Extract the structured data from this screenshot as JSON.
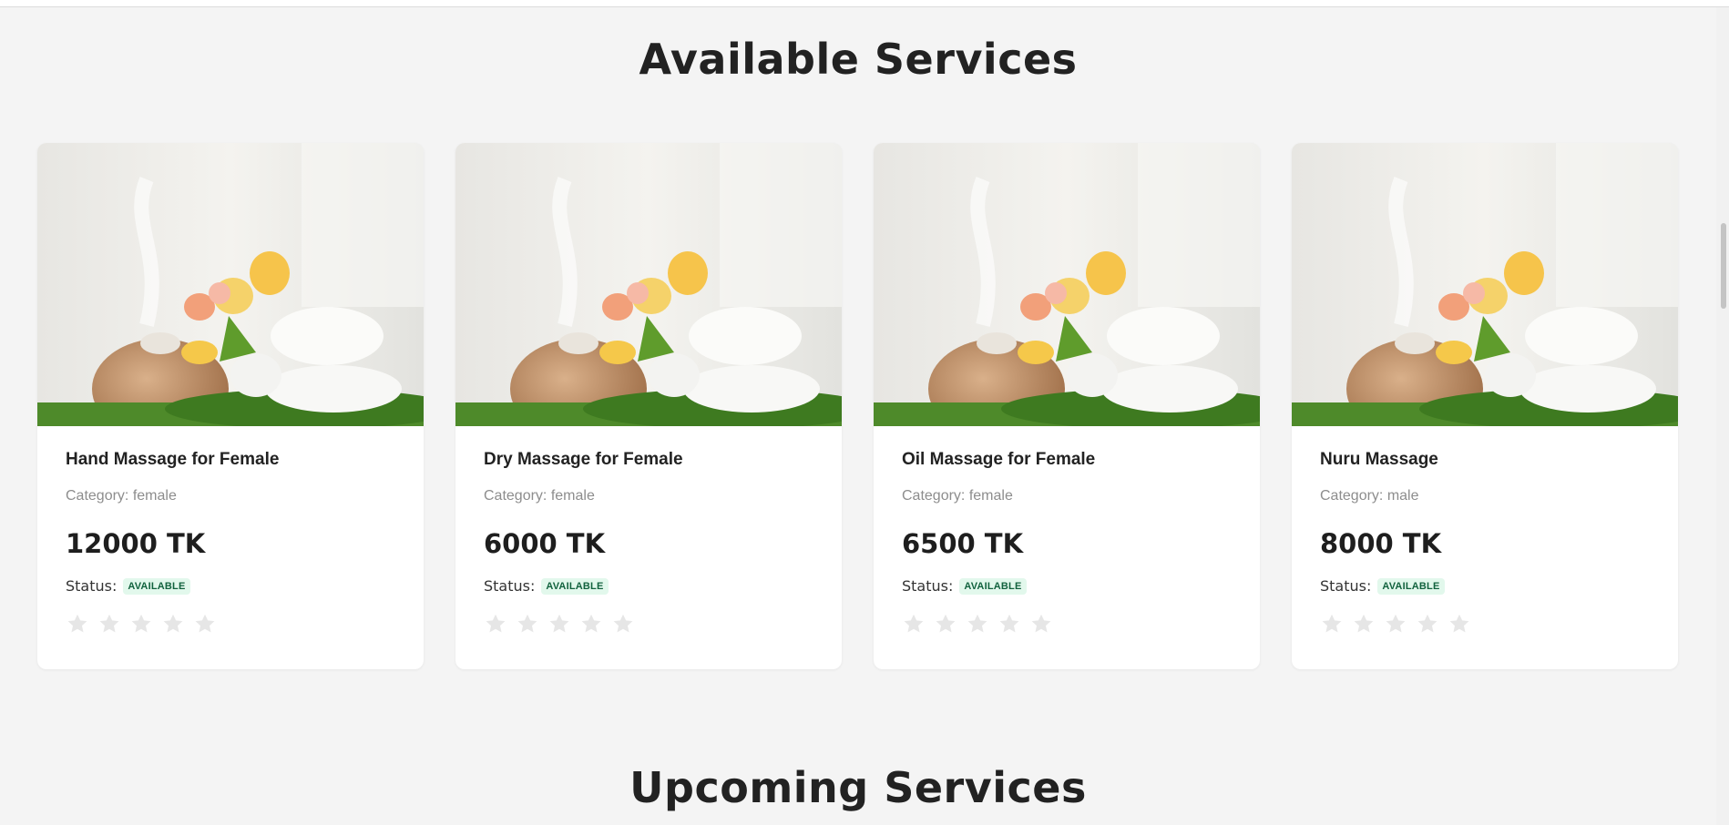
{
  "sections": {
    "available_title": "Available Services",
    "upcoming_title": "Upcoming Services"
  },
  "cards": [
    {
      "title": "Hand Massage for Female",
      "category": "Category: female",
      "price": "12000 TK",
      "status_label": "Status:",
      "status": "AVAILABLE",
      "rating": 0
    },
    {
      "title": "Dry Massage for Female",
      "category": "Category: female",
      "price": "6000 TK",
      "status_label": "Status:",
      "status": "AVAILABLE",
      "rating": 0
    },
    {
      "title": "Oil Massage for Female",
      "category": "Category: female",
      "price": "6500 TK",
      "status_label": "Status:",
      "status": "AVAILABLE",
      "rating": 0
    },
    {
      "title": "Nuru Massage",
      "category": "Category: male",
      "price": "8000 TK",
      "status_label": "Status:",
      "status": "AVAILABLE",
      "rating": 0
    }
  ],
  "colors": {
    "page_bg": "#f4f4f4",
    "badge_bg": "#e2f8ec",
    "badge_text": "#12623e",
    "star_empty": "#e6e6e6"
  },
  "icons": {
    "star": "star-icon",
    "image": "spa-towels-flowers-image"
  }
}
